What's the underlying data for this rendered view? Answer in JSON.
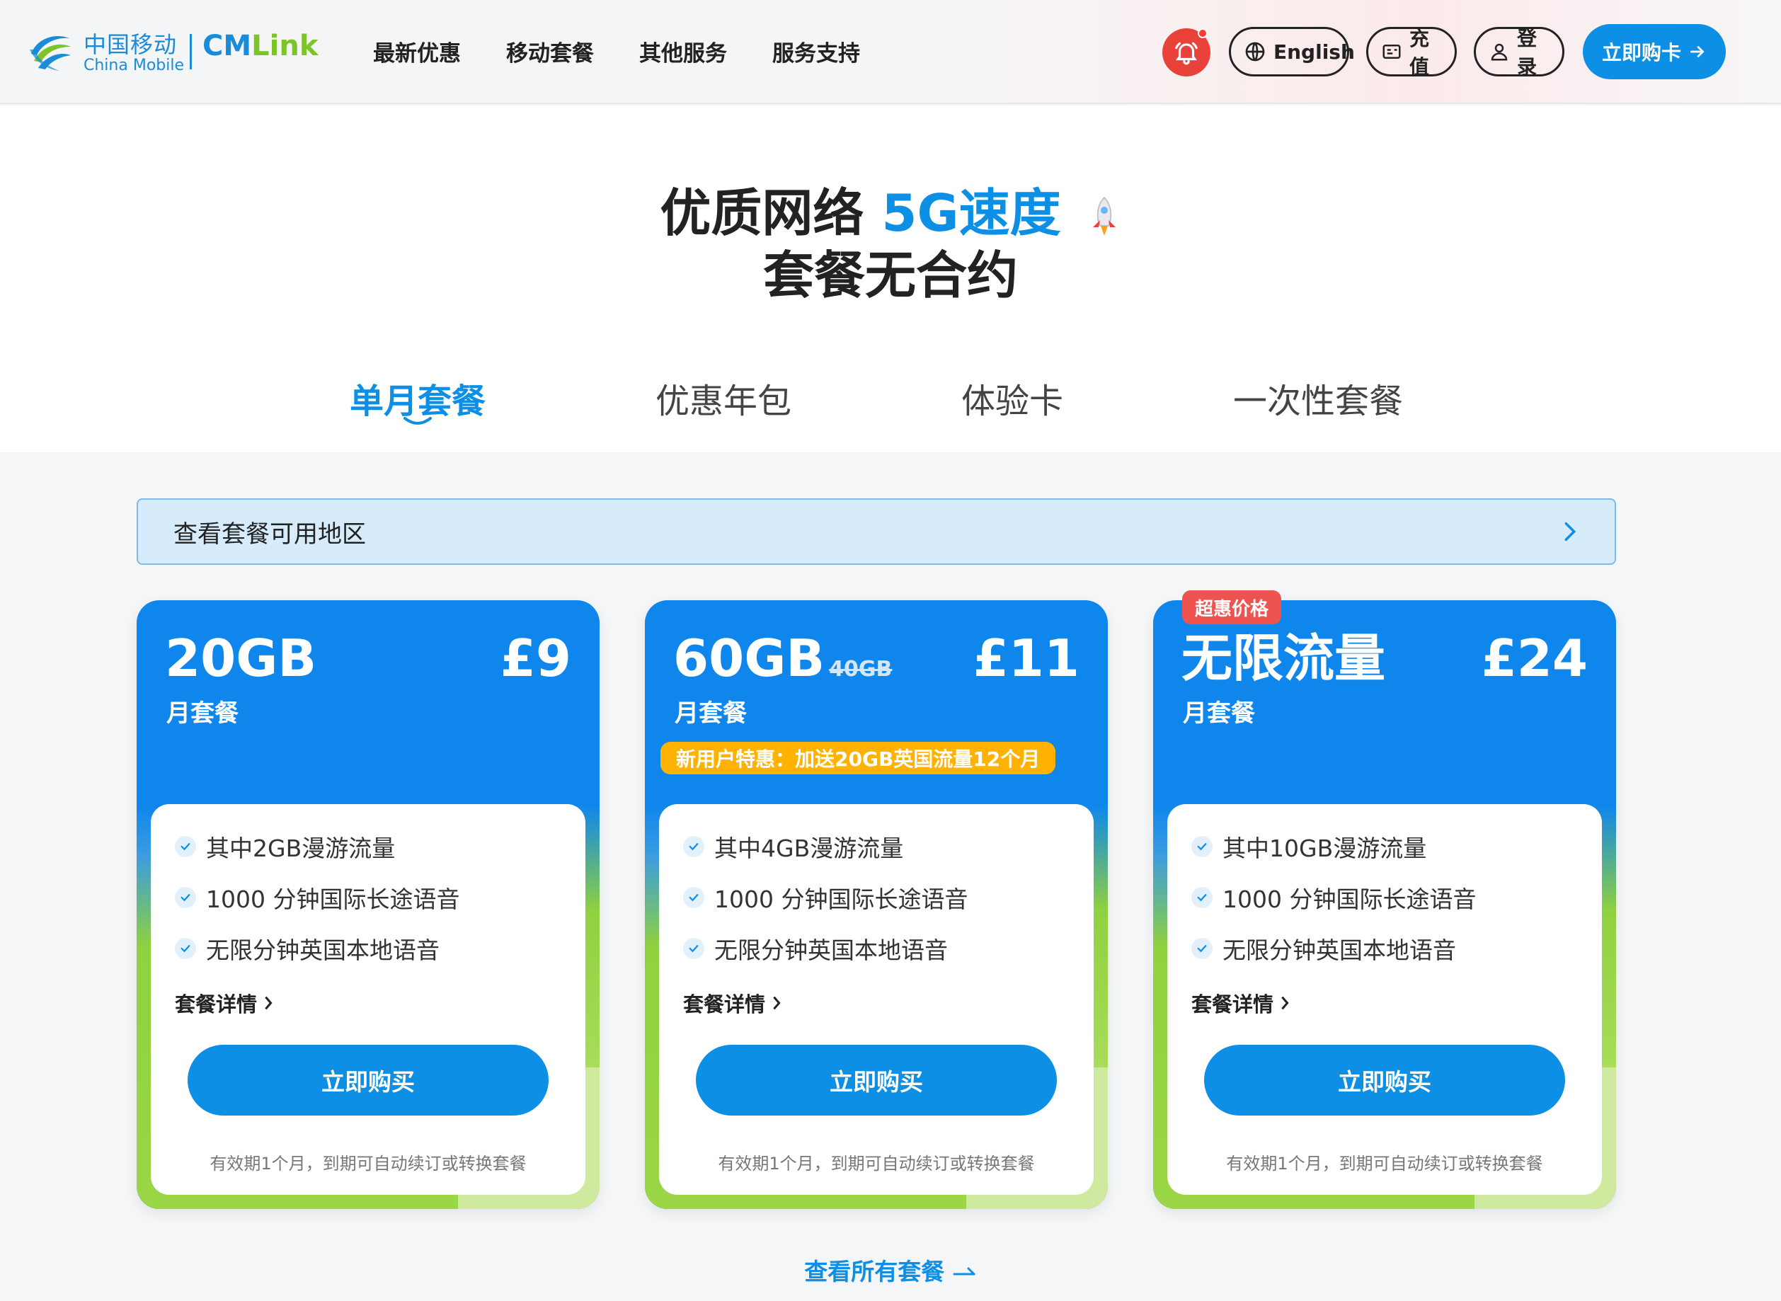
{
  "header": {
    "logo": {
      "cn": "中国移动",
      "en": "China Mobile",
      "brand_a": "CM",
      "brand_b": "Link"
    },
    "nav": [
      "最新优惠",
      "移动套餐",
      "其他服务",
      "服务支持"
    ],
    "language_label": "English",
    "topup_label": "充值",
    "login_label": "登录",
    "buy_card_label": "立即购卡"
  },
  "hero": {
    "title_prefix": "优质网络",
    "title_highlight": "5G速度",
    "title_line2": "套餐无合约"
  },
  "tabs": [
    {
      "label": "单月套餐",
      "active": true
    },
    {
      "label": "优惠年包",
      "active": false
    },
    {
      "label": "体验卡",
      "active": false
    },
    {
      "label": "一次性套餐",
      "active": false
    }
  ],
  "region_bar": {
    "label": "查看套餐可用地区"
  },
  "cards": [
    {
      "data": "20GB",
      "old_data": "",
      "price": "£9",
      "type": "月套餐",
      "promo": "",
      "tag": "",
      "features": [
        "其中2GB漫游流量",
        "1000 分钟国际长途语音",
        "无限分钟英国本地语音"
      ],
      "detail_label": "套餐详情",
      "buy_label": "立即购买",
      "note": "有效期1个月，到期可自动续订或转换套餐"
    },
    {
      "data": "60GB",
      "old_data": "40GB",
      "price": "£11",
      "type": "月套餐",
      "promo": "新用户特惠：加送20GB英国流量12个月",
      "tag": "",
      "features": [
        "其中4GB漫游流量",
        "1000 分钟国际长途语音",
        "无限分钟英国本地语音"
      ],
      "detail_label": "套餐详情",
      "buy_label": "立即购买",
      "note": "有效期1个月，到期可自动续订或转换套餐"
    },
    {
      "data": "无限流量",
      "old_data": "",
      "price": "£24",
      "type": "月套餐",
      "promo": "",
      "tag": "超惠价格",
      "features": [
        "其中10GB漫游流量",
        "1000 分钟国际长途语音",
        "无限分钟英国本地语音"
      ],
      "detail_label": "套餐详情",
      "buy_label": "立即购买",
      "note": "有效期1个月，到期可自动续订或转换套餐"
    }
  ],
  "view_all_label": "查看所有套餐",
  "colors": {
    "brand_blue": "#0d8fe6",
    "brand_green": "#7cc427",
    "promo_yellow": "#ffb300",
    "deal_red": "#ef5350",
    "bell_red": "#e9423b"
  },
  "icons": [
    "china-mobile-logo-icon",
    "bell-icon",
    "globe-icon",
    "topup-card-icon",
    "user-icon",
    "arrow-right-icon",
    "rocket-icon",
    "chevron-right-icon",
    "check-icon"
  ]
}
